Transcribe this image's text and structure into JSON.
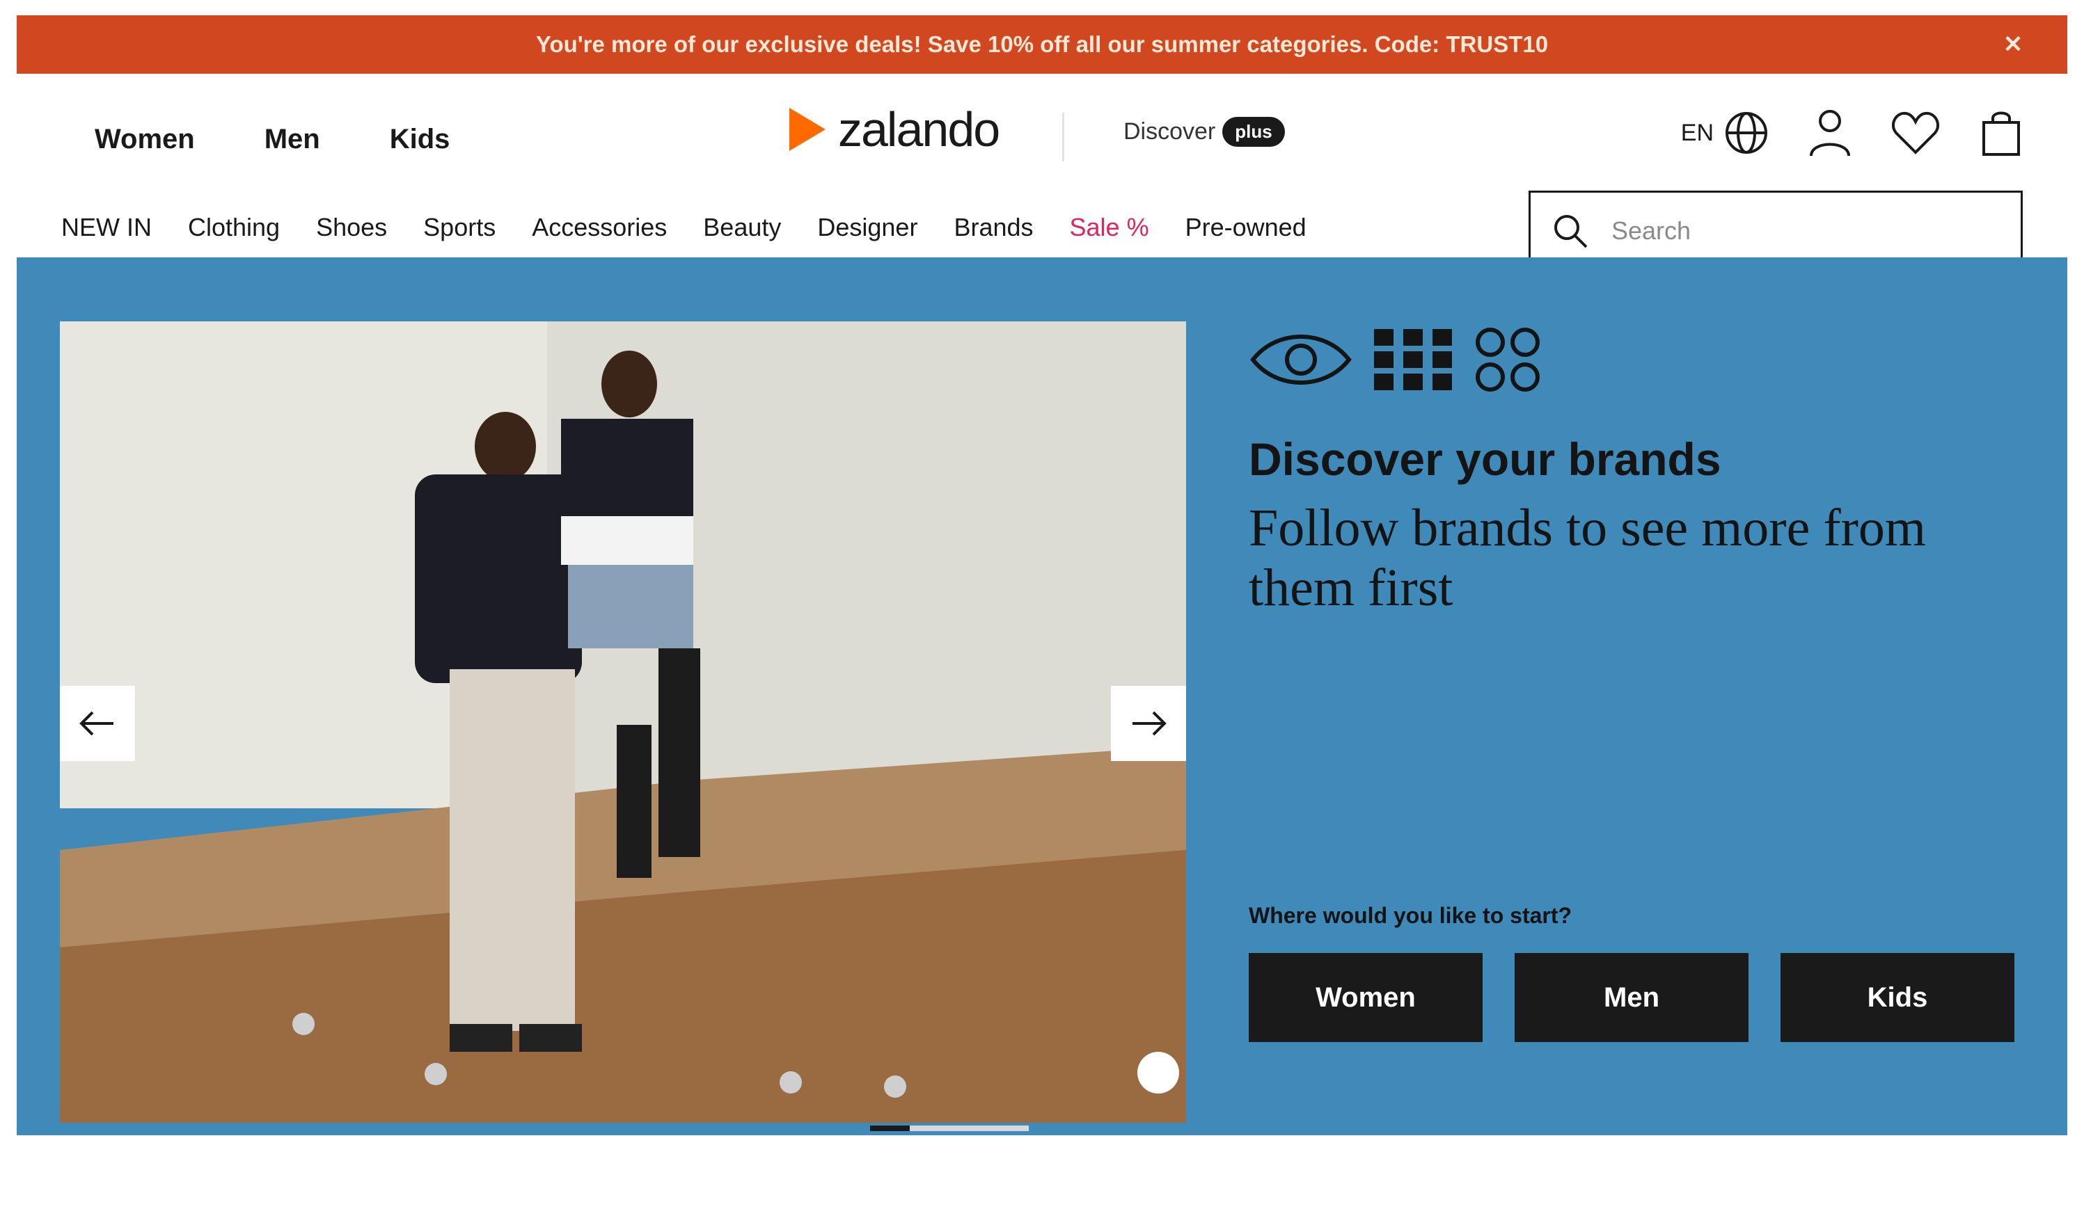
{
  "promo": {
    "text": "You're more of our exclusive deals! Save 10% off all our summer categories. Code: TRUST10",
    "close_icon": "close-icon"
  },
  "header": {
    "top_nav": [
      "Women",
      "Men",
      "Kids"
    ],
    "logo_text": "zalando",
    "plus_label": "Discover",
    "plus_badge": "plus",
    "lang_label": "EN",
    "icons": [
      "globe-icon",
      "account-icon",
      "wishlist-icon",
      "bag-icon"
    ],
    "categories": [
      "NEW IN",
      "Clothing",
      "Shoes",
      "Sports",
      "Accessories",
      "Beauty",
      "Designer",
      "Brands",
      "Sale %",
      "Pre-owned"
    ],
    "search_placeholder": "Search"
  },
  "hero": {
    "title": "Discover your brands",
    "subtitle": "Follow brands to see more from them first",
    "start_question": "Where would you like to start?",
    "buttons": [
      "Women",
      "Men",
      "Kids"
    ],
    "carousel_progress": 0.25,
    "colors": {
      "panel_bg": "#3f8ab9",
      "promo_bg": "#d1471f",
      "logo_orange": "#ff6900",
      "sale_red": "#e0245e"
    }
  }
}
